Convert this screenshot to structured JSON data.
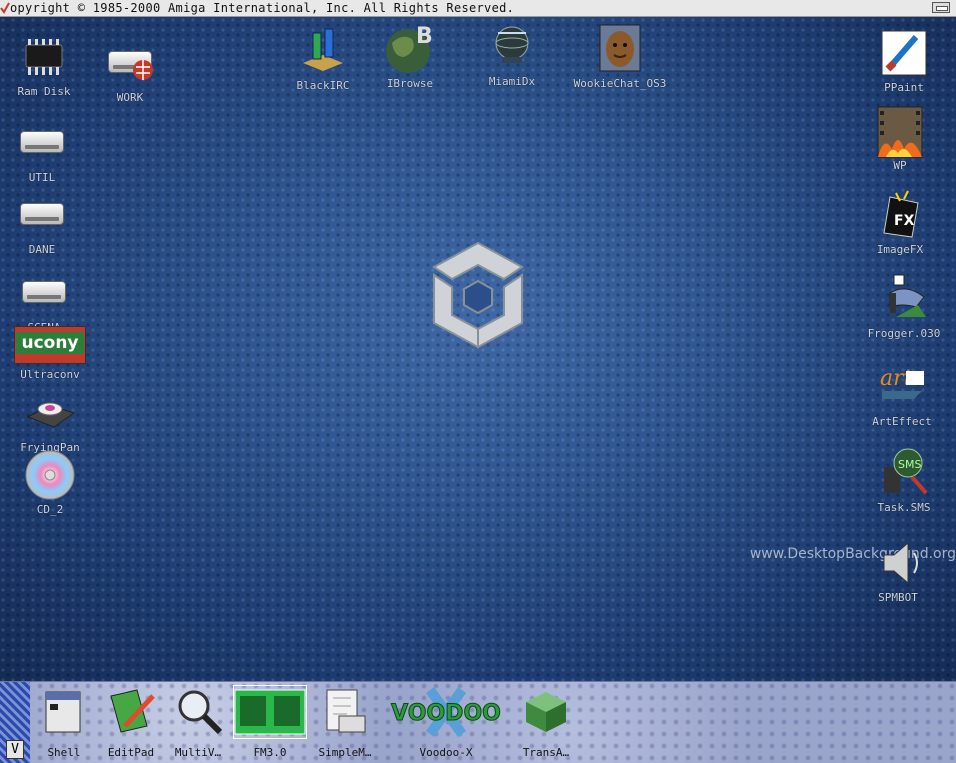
{
  "titlebar": {
    "text": "opyright © 1985-2000 Amiga International, Inc. All Rights Reserved."
  },
  "desktop": {
    "left_icons": [
      {
        "label": "Ram Disk",
        "icon": "ram-chip-icon"
      },
      {
        "label": "WORK",
        "icon": "drive-icon"
      },
      {
        "label": "UTIL",
        "icon": "drive-icon"
      },
      {
        "label": "DANE",
        "icon": "drive-icon"
      },
      {
        "label": "SCENA",
        "icon": "drive-icon"
      },
      {
        "label": "Ultraconv",
        "icon": "ultraconv-icon"
      },
      {
        "label": "FryingPan",
        "icon": "frying-pan-icon"
      },
      {
        "label": "CD_2",
        "icon": "cd-icon"
      }
    ],
    "top_icons": [
      {
        "label": "BlackIRC",
        "icon": "irc-icon"
      },
      {
        "label": "IBrowse",
        "icon": "globe-icon"
      },
      {
        "label": "MiamiDx",
        "icon": "network-icon"
      },
      {
        "label": "WookieChat_OS3",
        "icon": "wookie-icon"
      }
    ],
    "right_icons": [
      {
        "label": "PPaint",
        "icon": "paint-brush-icon"
      },
      {
        "label": "WP",
        "icon": "film-fire-icon"
      },
      {
        "label": "ImageFX",
        "icon": "imagefx-icon"
      },
      {
        "label": "Frogger.030",
        "icon": "frogger-icon"
      },
      {
        "label": "ArtEffect",
        "icon": "arteffect-icon"
      },
      {
        "label": "Task.SMS",
        "icon": "sms-icon"
      },
      {
        "label": "SPMBOT",
        "icon": "speaker-icon"
      }
    ],
    "ultraconv_text": "ucony",
    "watermark": "www.DesktopBackground.org",
    "imagefx_text": "FX",
    "artfx_text": "art",
    "sms_text": "SMS"
  },
  "dock": {
    "v_button": "V",
    "items": [
      {
        "label": "Shell",
        "icon": "shell-icon"
      },
      {
        "label": "EditPad",
        "icon": "notepad-pencil-icon"
      },
      {
        "label": "MultiV…",
        "icon": "magnifier-icon"
      },
      {
        "label": "FM3.0",
        "icon": "file-manager-icon"
      },
      {
        "label": "SimpleM…",
        "icon": "mail-icon"
      },
      {
        "label": "Voodoo-X",
        "icon": "voodoo-x-icon"
      },
      {
        "label": "TransA…",
        "icon": "cube-icon"
      }
    ],
    "voodoo_logo": "VOODOO"
  }
}
